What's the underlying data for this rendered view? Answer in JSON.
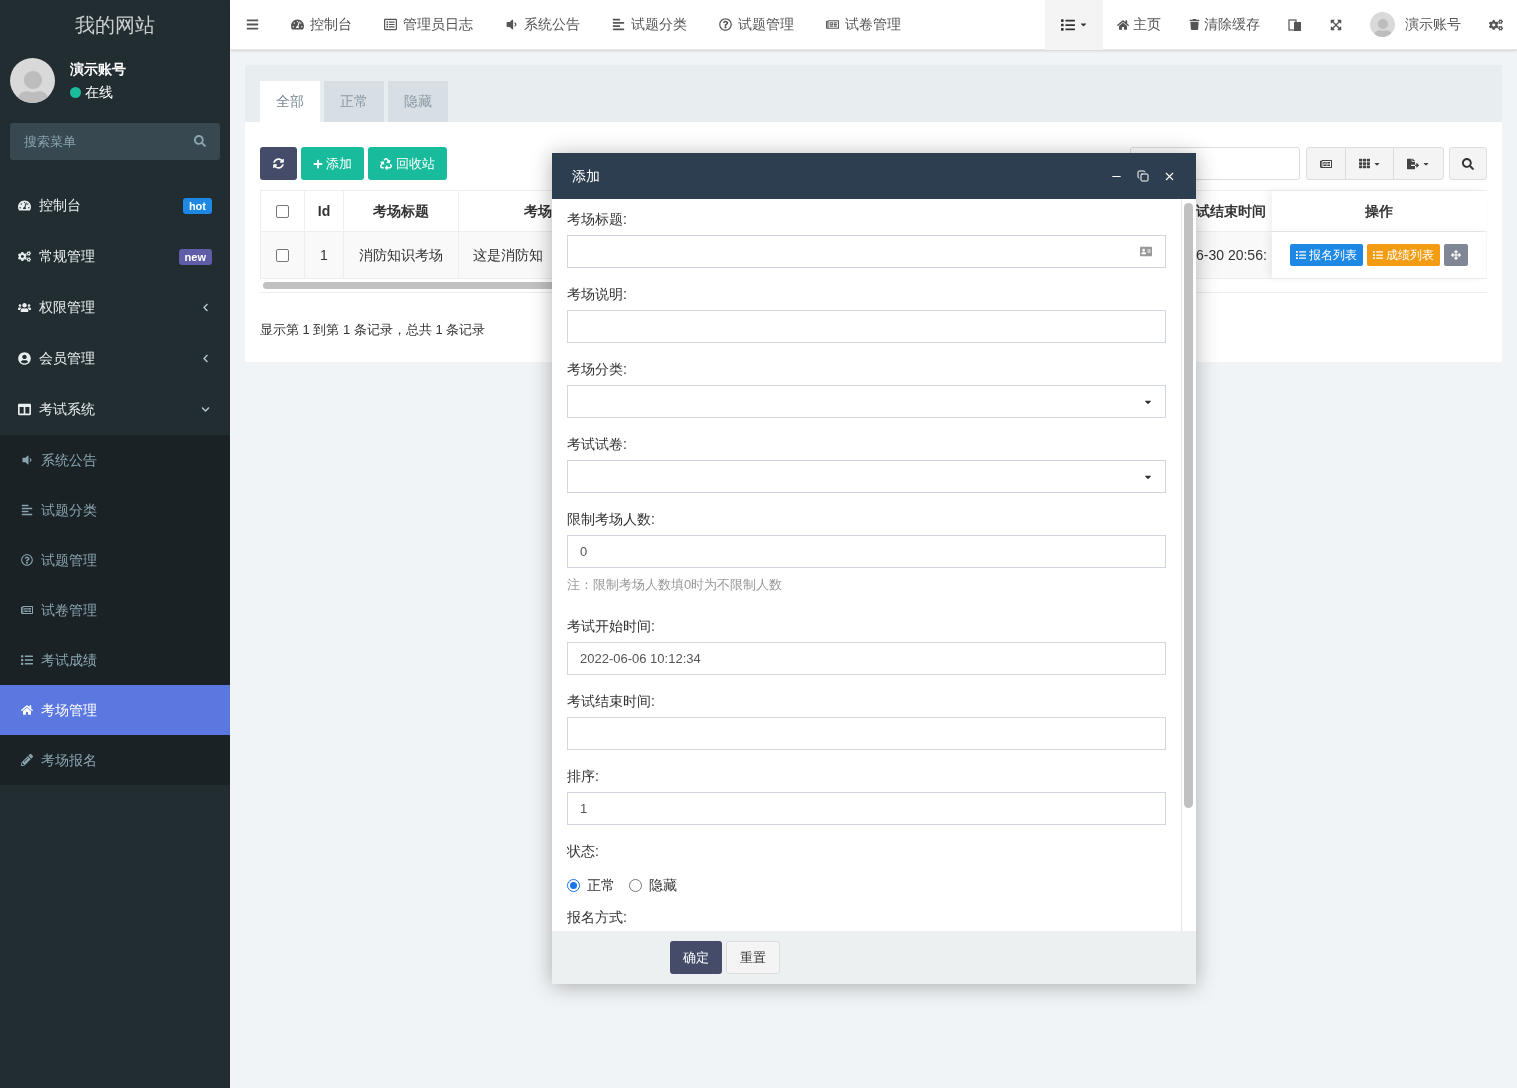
{
  "site_title": "我的网站",
  "user": {
    "name": "演示账号",
    "status": "在线",
    "online": true
  },
  "sidebar_search": {
    "placeholder": "搜索菜单"
  },
  "menu": [
    {
      "label": "控制台",
      "badge": "hot",
      "color": "#1e88e5",
      "kind": "item",
      "selected": false
    },
    {
      "label": "常规管理",
      "badge": "new",
      "color": "#605ca8",
      "kind": "item",
      "selected": false
    },
    {
      "label": "权限管理",
      "kind": "group",
      "expanded": false,
      "selected": false
    },
    {
      "label": "会员管理",
      "kind": "group",
      "expanded": false,
      "selected": false
    },
    {
      "label": "考试系统",
      "kind": "group",
      "expanded": true,
      "selected": false,
      "children": [
        {
          "label": "系统公告",
          "selected": false
        },
        {
          "label": "试题分类",
          "selected": false
        },
        {
          "label": "试题管理",
          "selected": false
        },
        {
          "label": "试卷管理",
          "selected": false
        },
        {
          "label": "考试成绩",
          "selected": false
        },
        {
          "label": "考场管理",
          "selected": true
        },
        {
          "label": "考场报名",
          "selected": false
        }
      ]
    }
  ],
  "top_nav": [
    "控制台",
    "管理员日志",
    "系统公告",
    "试题分类",
    "试题管理",
    "试卷管理"
  ],
  "top_right": {
    "home": "主页",
    "clear_cache": "清除缓存",
    "account": "演示账号"
  },
  "tabs": [
    {
      "label": "全部",
      "selected": true
    },
    {
      "label": "正常",
      "selected": false
    },
    {
      "label": "隐藏",
      "selected": false
    }
  ],
  "toolbar": {
    "add": "添加",
    "recycle": "回收站"
  },
  "table": {
    "select_all_checked": false,
    "columns": [
      "Id",
      "考场标题",
      "考场",
      "试结束时间",
      "操作"
    ],
    "rows": [
      {
        "checked": false,
        "cells": [
          "1",
          "消防知识考场",
          "这是消防知",
          "6-30 20:56:"
        ],
        "actions": [
          "报名列表",
          "成绩列表"
        ]
      }
    ]
  },
  "pagination_info": "显示第 1 到第 1 条记录，总共 1 条记录",
  "dialog": {
    "title": "添加",
    "fields": [
      {
        "kind": "text_icon",
        "label": "考场标题:"
      },
      {
        "kind": "text",
        "label": "考场说明:"
      },
      {
        "kind": "select",
        "label": "考场分类:"
      },
      {
        "kind": "select",
        "label": "考试试卷:"
      },
      {
        "kind": "text",
        "label": "限制考场人数:",
        "value": "0",
        "note": "注：限制考场人数填0时为不限制人数"
      },
      {
        "kind": "text",
        "label": "考试开始时间:",
        "value": "2022-06-06 10:12:34"
      },
      {
        "kind": "text",
        "label": "考试结束时间:"
      },
      {
        "kind": "text",
        "label": "排序:",
        "value": "1"
      },
      {
        "kind": "radio",
        "label": "状态:",
        "options": [
          {
            "label": "正常",
            "selected": true
          },
          {
            "label": "隐藏",
            "selected": false
          }
        ]
      },
      {
        "kind": "label",
        "label": "报名方式:"
      }
    ],
    "buttons": [
      "确定",
      "重置"
    ]
  }
}
